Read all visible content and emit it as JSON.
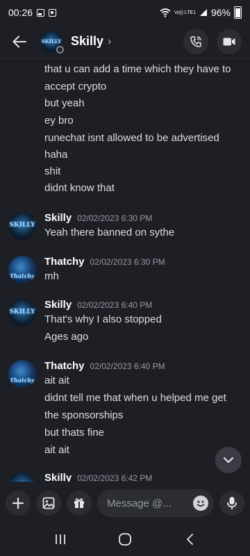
{
  "status_bar": {
    "time": "00:26",
    "network": "Vo)) LTE1",
    "battery": "96%"
  },
  "header": {
    "title": "Skilly",
    "chevron": "›"
  },
  "messages": {
    "continuation": [
      "that u can add a time which they have to",
      "accept crypto",
      "but yeah",
      "ey bro",
      "runechat isnt allowed to be advertised",
      "haha",
      "shit",
      "didnt know that"
    ],
    "groups": [
      {
        "author": "Skilly",
        "timestamp": "02/02/2023 6:30 PM",
        "lines": [
          "Yeah there banned on sythe"
        ]
      },
      {
        "author": "Thatchy",
        "timestamp": "02/02/2023 6:30 PM",
        "lines": [
          "mh"
        ]
      },
      {
        "author": "Skilly",
        "timestamp": "02/02/2023 6:40 PM",
        "lines": [
          "That's why I also stopped",
          "Ages ago"
        ]
      },
      {
        "author": "Thatchy",
        "timestamp": "02/02/2023 6:40 PM",
        "lines": [
          "ait ait",
          "didnt tell me that when u helped me get",
          "the sponsorships",
          "but thats fine",
          "ait ait"
        ]
      },
      {
        "author": "Skilly",
        "timestamp": "02/02/2023 6:42 PM",
        "lines": []
      }
    ]
  },
  "avatars": {
    "skilly": "SKILLY",
    "thatchy": "Thatchy"
  },
  "composer": {
    "placeholder": "Message @..."
  },
  "icons": {
    "back": "arrow-left-icon",
    "call": "phone-icon",
    "video": "video-camera-icon",
    "plus": "plus-icon",
    "gallery": "image-icon",
    "gift": "gift-icon",
    "emoji": "emoji-icon",
    "mic": "microphone-icon",
    "scroll": "chevron-down-icon"
  },
  "colors": {
    "background": "#1e1f24",
    "surface": "#2b2d31",
    "muted": "#949ba4"
  }
}
